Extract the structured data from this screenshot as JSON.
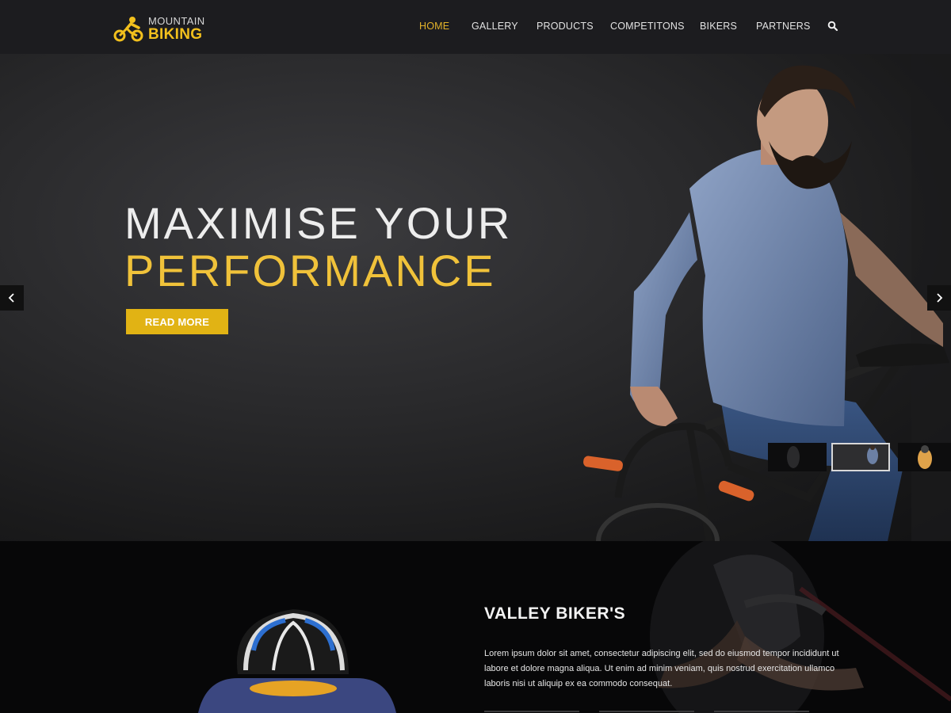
{
  "brand": {
    "top": "MOUNTAIN",
    "bottom": "BIKING",
    "accent_color": "#f2c01d"
  },
  "nav": {
    "items": [
      {
        "label": "HOME",
        "active": true
      },
      {
        "label": "GALLERY",
        "active": false
      },
      {
        "label": "PRODUCTS",
        "active": false
      },
      {
        "label": "COMPETITONS",
        "active": false
      },
      {
        "label": "BIKERS",
        "active": false
      },
      {
        "label": "PARTNERS",
        "active": false
      }
    ],
    "search_icon": "search-icon"
  },
  "hero": {
    "line1": "MAXIMISE YOUR",
    "line2": "PERFORMANCE",
    "button": "READ MORE",
    "prev_icon": "chevron-left-icon",
    "next_icon": "chevron-right-icon",
    "active_thumbnail": 2,
    "thumbnail_count": 3
  },
  "section": {
    "title": "VALLEY BIKER'S",
    "body": "Lorem ipsum dolor sit amet, consectetur adipiscing elit, sed do eiusmod tempor incididunt ut labore et dolore magna aliqua. Ut enim ad minim veniam, quis nostrud exercitation ullamco laboris nisi ut aliquip ex ea commodo consequat."
  },
  "colors": {
    "accent": "#e1b314",
    "header_bg": "#1c1c1f",
    "nav_active": "#e2b22a"
  }
}
